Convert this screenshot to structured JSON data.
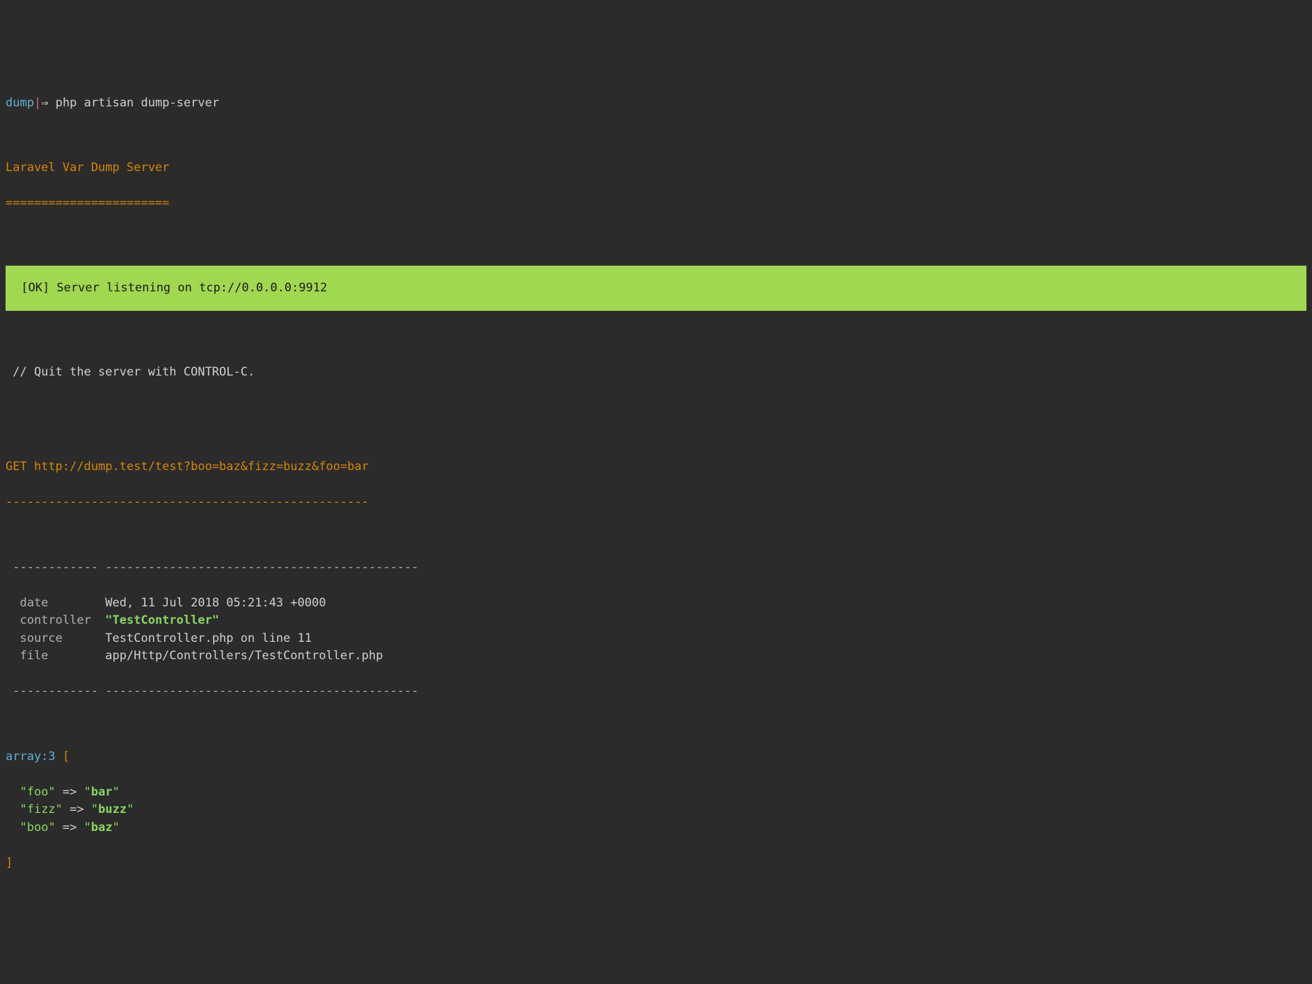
{
  "prompt": {
    "context": "dump",
    "pipe": "|",
    "arrow": "⇒",
    "command": "php artisan dump-server"
  },
  "header": {
    "title": "Laravel Var Dump Server",
    "underline": "======================="
  },
  "banner": {
    "text": " [OK] Server listening on tcp://0.0.0.0:9912"
  },
  "hint": {
    "text": " // Quit the server with CONTROL-C."
  },
  "request": {
    "line": "GET http://dump.test/test?boo=baz&fizz=buzz&foo=bar",
    "dashes": "---------------------------------------------------"
  },
  "meta": {
    "top_dashes_left": " ------------",
    "top_dashes_right": " --------------------------------------------",
    "bottom_dashes_left": " ------------",
    "bottom_dashes_right": " --------------------------------------------",
    "rows": [
      {
        "key": "  date       ",
        "value_plain": " Wed, 11 Jul 2018 05:21:43 +0000",
        "is_string": false
      },
      {
        "key": "  controller ",
        "value_string": " \"TestController\"",
        "is_string": true
      },
      {
        "key": "  source     ",
        "value_plain": " TestController.php on line 11",
        "is_string": false
      },
      {
        "key": "  file       ",
        "value_plain": " app/Http/Controllers/TestController.php",
        "is_string": false
      }
    ]
  },
  "dump": {
    "type": "array:3",
    "open": " [",
    "close": "]",
    "entries": [
      {
        "indent": "  ",
        "key": "\"foo\"",
        "arrow": " => ",
        "val_quote_open": "\"",
        "val": "bar",
        "val_quote_close": "\""
      },
      {
        "indent": "  ",
        "key": "\"fizz\"",
        "arrow": " => ",
        "val_quote_open": "\"",
        "val": "buzz",
        "val_quote_close": "\""
      },
      {
        "indent": "  ",
        "key": "\"boo\"",
        "arrow": " => ",
        "val_quote_open": "\"",
        "val": "baz",
        "val_quote_close": "\""
      }
    ]
  }
}
